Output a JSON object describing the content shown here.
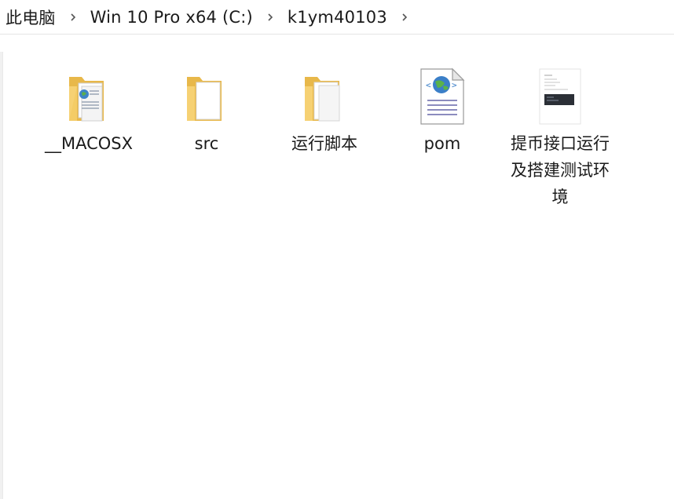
{
  "breadcrumb": {
    "items": [
      "此电脑",
      "Win 10 Pro x64 (C:)",
      "k1ym40103"
    ]
  },
  "files": [
    {
      "label": "__MACOSX",
      "icon": "folder-with-documents-icon",
      "kind": "folder"
    },
    {
      "label": "src",
      "icon": "folder-icon",
      "kind": "folder"
    },
    {
      "label": "运行脚本",
      "icon": "folder-icon",
      "kind": "folder"
    },
    {
      "label": "pom",
      "icon": "xml-file-icon",
      "kind": "file"
    },
    {
      "label": "提币接口运行及搭建测试环境",
      "icon": "image-thumbnail-icon",
      "kind": "file"
    }
  ],
  "colors": {
    "folder_body": "#f6d173",
    "folder_back": "#e8b84a",
    "separator": "#e5e5e5",
    "text": "#1a1a1a"
  }
}
